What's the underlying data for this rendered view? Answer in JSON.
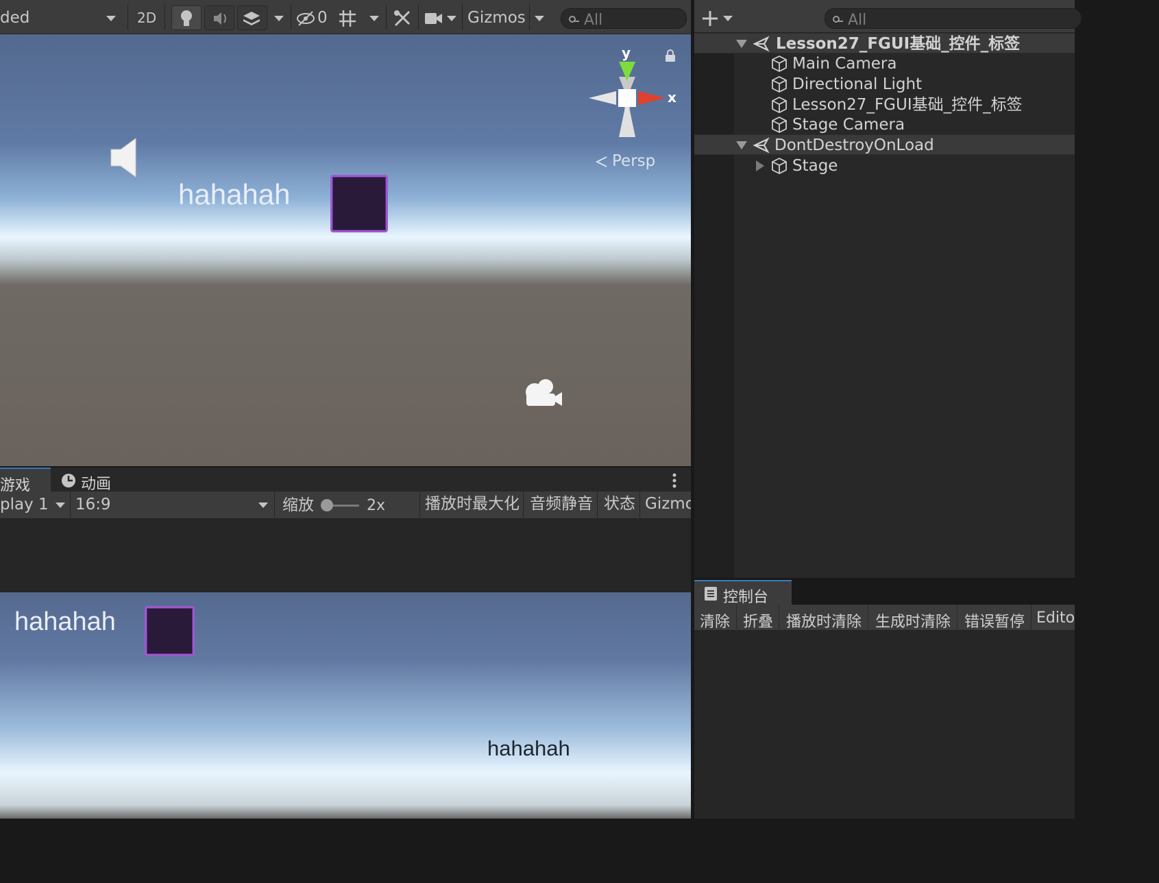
{
  "scene_toolbar": {
    "draw_mode": "ded",
    "mode_2d": "2D",
    "hidden_count": "0",
    "gizmos": "Gizmos",
    "search_placeholder": "All",
    "icons": [
      "bulb-icon",
      "audio-icon",
      "effects-icon",
      "visibility-icon",
      "grid-icon",
      "tools-icon",
      "camera-icon"
    ]
  },
  "scene_view": {
    "world_label": "hahahah",
    "gizmo_x": "x",
    "gizmo_y": "y",
    "projection": "Persp",
    "icons": [
      "audio-source-icon",
      "camera-gizmo-icon",
      "lock-icon"
    ]
  },
  "game_tabs": {
    "game": "游戏",
    "animation": "动画"
  },
  "game_toolbar": {
    "display": "play 1",
    "aspect": "16:9",
    "scale_label": "缩放",
    "scale_value": "2x",
    "maximize": "播放时最大化",
    "mute": "音频静音",
    "stats": "状态",
    "gizmos": "Gizmo"
  },
  "game_view": {
    "label_top": "hahahah",
    "label_bottom": "hahahah"
  },
  "hierarchy": {
    "search_placeholder": "All",
    "items": [
      {
        "label": "Lesson27_FGUI基础_控件_标签",
        "kind": "scene"
      },
      {
        "label": "Main Camera",
        "kind": "object"
      },
      {
        "label": "Directional Light",
        "kind": "object"
      },
      {
        "label": "Lesson27_FGUI基础_控件_标签",
        "kind": "object"
      },
      {
        "label": "Stage Camera",
        "kind": "object"
      },
      {
        "label": "DontDestroyOnLoad",
        "kind": "scene"
      },
      {
        "label": "Stage",
        "kind": "object"
      }
    ]
  },
  "console": {
    "tab": "控制台",
    "buttons": [
      "清除",
      "折叠",
      "播放时清除",
      "生成时清除",
      "错误暂停",
      "Edito"
    ]
  }
}
